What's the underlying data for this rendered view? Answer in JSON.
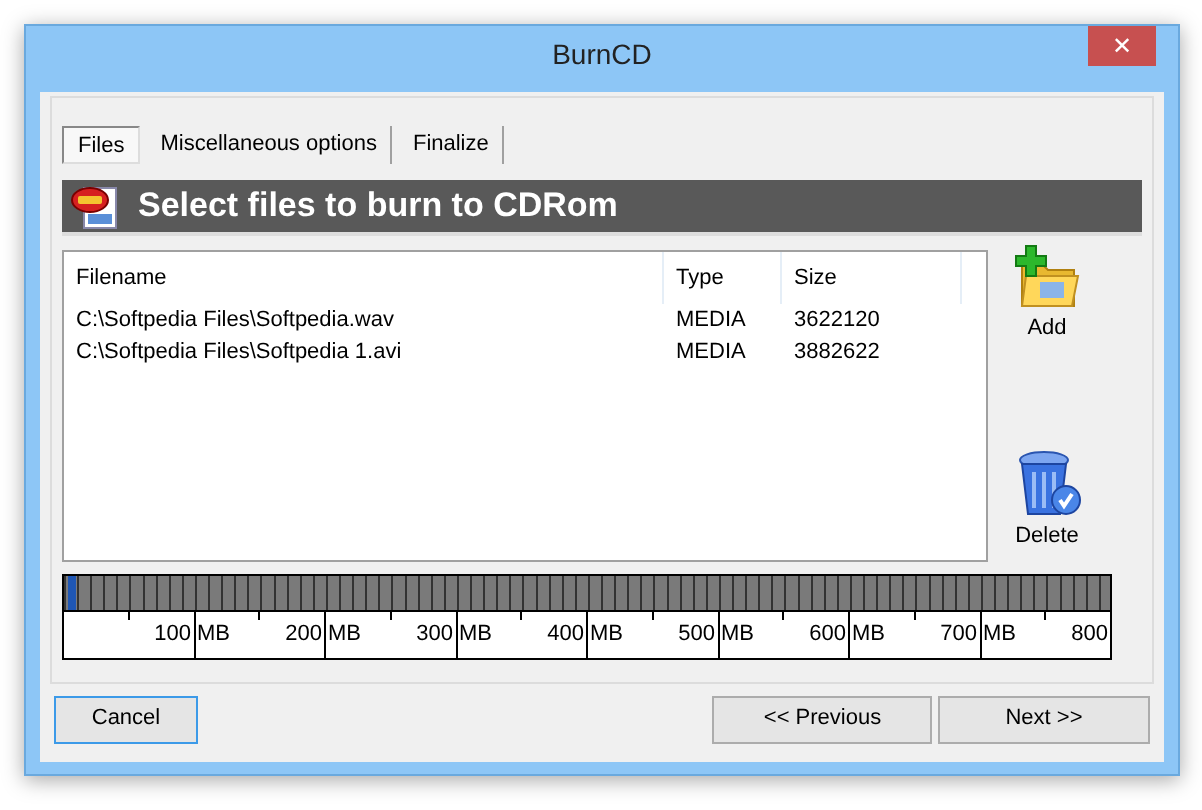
{
  "window": {
    "title": "BurnCD",
    "close": "✕"
  },
  "tabs": [
    {
      "label": "Files",
      "selected": true
    },
    {
      "label": "Miscellaneous options",
      "selected": false
    },
    {
      "label": "Finalize",
      "selected": false
    }
  ],
  "header": {
    "title": "Select files to burn to CDRom"
  },
  "file_list": {
    "columns": [
      "Filename",
      "Type",
      "Size"
    ],
    "rows": [
      [
        "C:\\Softpedia Files\\Softpedia.wav",
        "MEDIA",
        "3622120"
      ],
      [
        "C:\\Softpedia Files\\Softpedia 1.avi",
        "MEDIA",
        "3882622"
      ]
    ]
  },
  "side_buttons": [
    {
      "kind": "add",
      "label": "Add"
    },
    {
      "kind": "delete",
      "label": "Delete"
    }
  ],
  "capacity": {
    "level": 0.008,
    "scale": [
      {
        "value": "100",
        "unit": "MB"
      },
      {
        "value": "200",
        "unit": "MB"
      },
      {
        "value": "300",
        "unit": "MB"
      },
      {
        "value": "400",
        "unit": "MB"
      },
      {
        "value": "500",
        "unit": "MB"
      },
      {
        "value": "600",
        "unit": "MB"
      },
      {
        "value": "700",
        "unit": "MB"
      },
      {
        "value": "800"
      }
    ]
  },
  "buttons": {
    "cancel": "Cancel",
    "previous": "<< Previous",
    "next": "Next >>"
  }
}
